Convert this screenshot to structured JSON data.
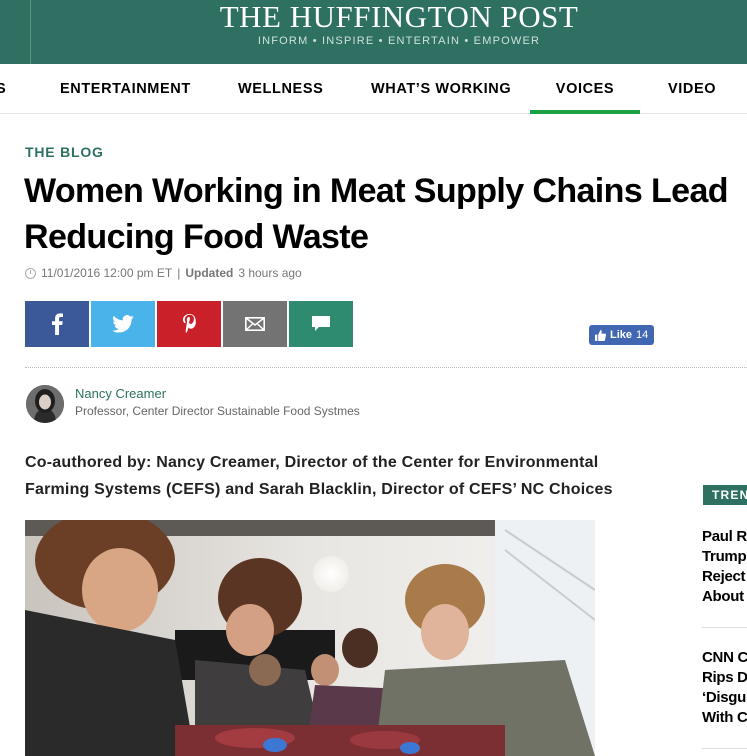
{
  "header": {
    "logo": "THE HUFFINGTON POST",
    "tagline": "INFORM • INSPIRE • ENTERTAIN • EMPOWER",
    "brand_color": "#2e7061"
  },
  "nav": {
    "items": [
      {
        "label": "S"
      },
      {
        "label": "ENTERTAINMENT"
      },
      {
        "label": "WELLNESS"
      },
      {
        "label": "WHAT’S WORKING"
      },
      {
        "label": "VOICES"
      },
      {
        "label": "VIDEO"
      }
    ],
    "active": "VOICES",
    "active_color": "#1aa146"
  },
  "article": {
    "section": "THE BLOG",
    "headline_line1": "Women Working in Meat Supply Chains Lead",
    "headline_line2": "Reducing Food Waste",
    "date": "11/01/2016 12:00 pm ET",
    "separator": "|",
    "updated_label": "Updated",
    "updated_value": "3 hours ago",
    "intro_line1": "Co-authored by: Nancy Creamer, Director of the Center for Environmental",
    "intro_line2": "Farming Systems (CEFS) and Sarah Blacklin, Director of CEFS’ NC Choices"
  },
  "share": {
    "buttons": [
      {
        "name": "facebook-icon",
        "color": "#3b5998"
      },
      {
        "name": "twitter-icon",
        "color": "#4ab3ea"
      },
      {
        "name": "pinterest-icon",
        "color": "#c9202a"
      },
      {
        "name": "email-icon",
        "color": "#737373"
      },
      {
        "name": "comment-icon",
        "color": "#2e8b6f"
      }
    ],
    "like_label": "Like",
    "like_count": "14"
  },
  "author": {
    "name": "Nancy Creamer",
    "title": "Professor, Center Director Sustainable Food Systmes"
  },
  "trending": {
    "label": "TRENDING",
    "items": [
      {
        "lines": [
          "Paul R",
          "Trump",
          "Reject",
          "About"
        ]
      },
      {
        "lines": [
          "CNN C",
          "Rips D",
          "‘Disgu",
          "With C"
        ]
      }
    ]
  }
}
